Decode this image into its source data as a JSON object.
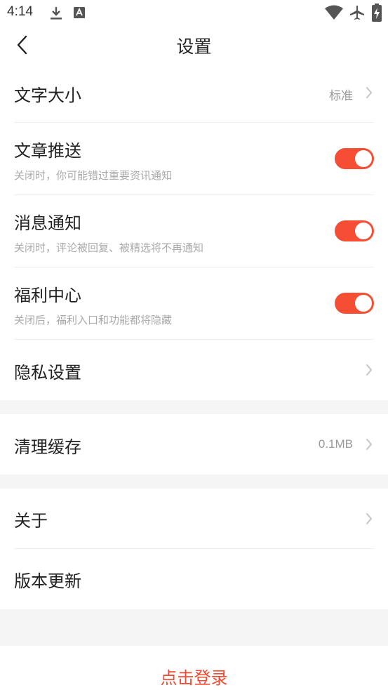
{
  "status_bar": {
    "time": "4:14",
    "left_icons": [
      "download-icon",
      "app-notification-icon"
    ],
    "right_icons": [
      "wifi-icon",
      "airplane-mode-icon",
      "battery-charging-icon"
    ]
  },
  "header": {
    "title": "设置",
    "back_icon": "chevron-left-icon"
  },
  "settings": {
    "font_size": {
      "label": "文字大小",
      "value": "标准"
    },
    "article_push": {
      "label": "文章推送",
      "desc": "关闭时，你可能错过重要资讯通知",
      "enabled": true
    },
    "message_notify": {
      "label": "消息通知",
      "desc": "关闭时，评论被回复、被精选将不再通知",
      "enabled": true
    },
    "welfare_center": {
      "label": "福利中心",
      "desc": "关闭后，福利入口和功能都将隐藏",
      "enabled": true
    },
    "privacy": {
      "label": "隐私设置"
    }
  },
  "cache": {
    "label": "清理缓存",
    "value": "0.1MB"
  },
  "about": {
    "label": "关于"
  },
  "version": {
    "label": "版本更新"
  },
  "login": {
    "label": "点击登录"
  },
  "colors": {
    "accent": "#f54e35",
    "login_text": "#f04a32",
    "page_bg": "#f5f5f5",
    "card_bg": "#ffffff"
  }
}
